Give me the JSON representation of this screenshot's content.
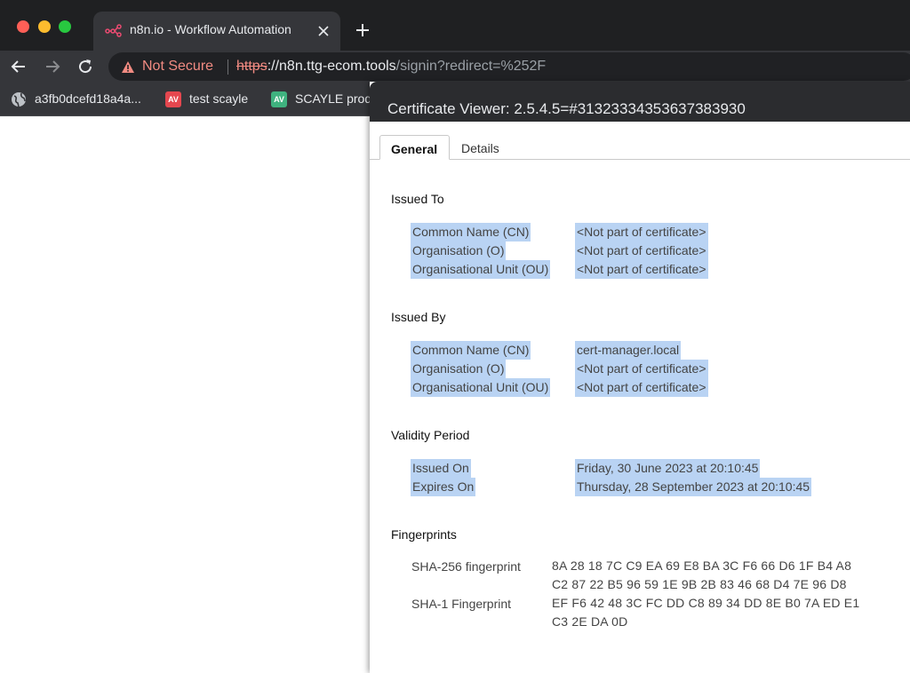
{
  "browser": {
    "tab": {
      "title": "n8n.io - Workflow Automation",
      "favicon": "n8n-logo-icon"
    },
    "address_bar": {
      "security_label": "Not Secure",
      "url_scheme": "https",
      "url_host": "://n8n.ttg-ecom.tools",
      "url_path": "/signin?redirect=%252F"
    },
    "bookmarks": [
      {
        "label": "a3fb0dcefd18a4a...",
        "icon": "globe-icon"
      },
      {
        "label": "test scayle",
        "icon": "AV",
        "color": "#e5474f"
      },
      {
        "label": "SCAYLE prod",
        "icon": "AV",
        "color": "#3fb27f"
      }
    ]
  },
  "certificate_viewer": {
    "title": "Certificate Viewer: 2.5.4.5=#31323334353637383930",
    "tabs": [
      "General",
      "Details"
    ],
    "active_tab": "General",
    "issued_to": {
      "heading": "Issued To",
      "rows": [
        {
          "label": "Common Name (CN)",
          "value": "<Not part of certificate>"
        },
        {
          "label": "Organisation (O)",
          "value": "<Not part of certificate>"
        },
        {
          "label": "Organisational Unit (OU)",
          "value": "<Not part of certificate>"
        }
      ]
    },
    "issued_by": {
      "heading": "Issued By",
      "rows": [
        {
          "label": "Common Name (CN)",
          "value": "cert-manager.local"
        },
        {
          "label": "Organisation (O)",
          "value": "<Not part of certificate>"
        },
        {
          "label": "Organisational Unit (OU)",
          "value": "<Not part of certificate>"
        }
      ]
    },
    "validity": {
      "heading": "Validity Period",
      "rows": [
        {
          "label": "Issued On",
          "value": "Friday, 30 June 2023 at 20:10:45"
        },
        {
          "label": "Expires On",
          "value": "Thursday, 28 September 2023 at 20:10:45"
        }
      ]
    },
    "fingerprints": {
      "heading": "Fingerprints",
      "rows": [
        {
          "label": "SHA-256 fingerprint",
          "value_line1": "8A 28 18 7C C9 EA 69 E8 BA 3C F6 66 D6 1F B4 A8",
          "value_line2": "C2 87 22 B5 96 59 1E 9B 2B 83 46 68 D4 7E 96 D8"
        },
        {
          "label": "SHA-1 Fingerprint",
          "value_line1": "EF F6 42 48 3C FC DD C8 89 34 DD 8E B0 7A ED E1",
          "value_line2": "C3 2E DA 0D"
        }
      ]
    }
  },
  "colors": {
    "chrome_dark": "#35363a",
    "titlebar": "#1f2022",
    "warning": "#f28b82",
    "selection": "#b9d3f3"
  }
}
